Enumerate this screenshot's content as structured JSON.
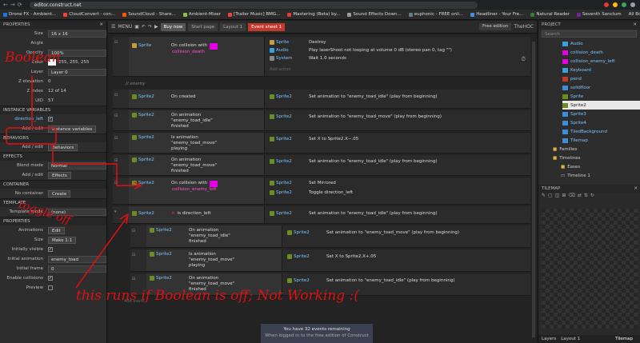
{
  "browser": {
    "url": "editor.construct.net",
    "bookmarks": [
      {
        "label": "Drone FX - Ambient...",
        "color": "#1a73e8"
      },
      {
        "label": "CloudConvert - con...",
        "color": "#f44336"
      },
      {
        "label": "SoundCloud - Share...",
        "color": "#ff5500"
      },
      {
        "label": "Ambient-Mixer",
        "color": "#8bc34a"
      },
      {
        "label": "[Trailer Music] BMG...",
        "color": "#f44336"
      },
      {
        "label": "Mastering (Beta) by...",
        "color": "#e53935"
      },
      {
        "label": "Sound Effects Down...",
        "color": "#9e9e9e"
      },
      {
        "label": "euphonic - FREE onli...",
        "color": "#607d8b"
      },
      {
        "label": "Headliner - Your Fre...",
        "color": "#4a90e2"
      },
      {
        "label": "Natural Reader",
        "color": "#2e7d32"
      },
      {
        "label": "Seventh Sanctum",
        "color": "#7b1fa2"
      }
    ],
    "all_bookmarks": "All Bookmarks"
  },
  "left_panel": {
    "title": "PROPERTIES",
    "size_label": "Size",
    "size_value": "16 x 16",
    "angle_label": "Angle",
    "opacity_label": "Opacity",
    "opacity_value": "100%",
    "color_label": "Color",
    "color_value": "255, 255, 255",
    "layer_label": "Layer",
    "layer_value": "Layer 0",
    "zelev_label": "Z elevation",
    "zelev_value": "0",
    "zindex_label": "Z index",
    "zindex_value": "12 of 14",
    "uid_label": "UID",
    "uid_value": "57",
    "instance_vars_section": "INSTANCE VARIABLES",
    "var_name": "direction_left",
    "addedit_label": "Add / edit",
    "instance_vars_button": "Instance variables",
    "behaviors_section": "BEHAVIORS",
    "behaviors_addedit": "Add / edit",
    "behaviors_button": "Behaviors",
    "effects_section": "EFFECTS",
    "blend_label": "Blend mode",
    "blend_value": "Normal",
    "effects_addedit": "Add / edit",
    "effects_button": "Effects",
    "container_section": "CONTAINER",
    "container_label": "No container",
    "create_button": "Create",
    "template_section": "TEMPLATE",
    "template_mode_label": "Template mode",
    "template_mode_value": "(none)",
    "properties_section": "PROPERTIES",
    "animations_label": "Animations",
    "edit_button": "Edit",
    "size2_label": "Size",
    "make11_button": "Make 1:1",
    "initially_visible_label": "Initially visible",
    "initial_anim_label": "Initial animation",
    "initial_anim_value": "enemy_toad",
    "initial_frame_label": "Initial frame",
    "initial_frame_value": "0",
    "enable_collisions_label": "Enable collisions",
    "preview_label": "Preview"
  },
  "toolbar": {
    "menu": "MENU",
    "tabs": [
      "Start page",
      "Layout 1",
      "Event sheet 1"
    ],
    "buy_now": "Buy now",
    "free_edition": "Free edition",
    "user": "TheHOC"
  },
  "events": {
    "comment": "// enemy",
    "e1_obj": "Sprite",
    "e1_cond": "On collision with",
    "e1_target": "collision_death",
    "e1_a1_obj": "Sprite",
    "e1_a1": "Destroy",
    "e1_a2_obj": "Audio",
    "e1_a2": "Play laserShoot not looping at volume 0 dB (stereo pan 0, tag \"\")",
    "e1_a3_obj": "System",
    "e1_a3": "Wait 1.0 seconds",
    "add_action": "Add action",
    "e2_obj": "Sprite2",
    "e2_cond": "On created",
    "e2_act": "Set animation to \"enemy_toad_idle\" (play from beginning)",
    "e3_cond": "On animation \"enemy_toad_idle\" finished",
    "e3_act": "Set animation to \"enemy_toad_move\" (play from beginning)",
    "e4_cond": "Is animation \"enemy_toad_move\" playing",
    "e4_act": "Set X to Sprite2.X−.05",
    "e5_cond": "On animation \"enemy_toad_move\" finished",
    "e5_act": "Set animation to \"enemy_toad_idle\" (play from beginning)",
    "e6_cond": "On collision with",
    "e6_target": "collision_enemy_left",
    "e6_a1": "Set Mirrored",
    "e6_a2": "Toggle direction_left",
    "e7_cond": "is direction_left",
    "e7_act": "Set animation to \"enemy_toad_idle\" (play from beginning)",
    "s1_cond": "On animation \"enemy_toad_idle\" finished",
    "s1_act": "Set animation to \"enemy_toad_move\" (play from beginning)",
    "s2_cond": "Is animation \"enemy_toad_move\" playing",
    "s2_act": "Set X to Sprite2.X+.05",
    "s3_cond": "On animation \"enemy_toad_move\" finished",
    "s3_act": "Set animation to \"enemy_toad_idle\" (play from beginning)",
    "add_event": "Add event"
  },
  "notice": {
    "title": "You have 32 events remaining",
    "body": "When logged in to the free edition of Construct"
  },
  "project": {
    "title": "PROJECT",
    "search_placeholder": "Search",
    "items": [
      "Audio",
      "collision_death",
      "collision_enemy_left",
      "Keyboard",
      "pend",
      "solidfloor",
      "Sprite",
      "Sprite2",
      "Sprite3",
      "Sprite4",
      "TiledBackground",
      "Tilemap"
    ],
    "families": "Families",
    "timelines": "Timelines",
    "eases": "Eases",
    "timeline1": "Timeline 1"
  },
  "tilemap_panel": {
    "title": "TILEMAP",
    "bottom_tabs": [
      "Layers",
      "Layout 1",
      "Tilemap"
    ]
  },
  "annotations": {
    "boolean": "Boolean",
    "toggle_off": "toggle off",
    "runs_off": "this runs if Boolean is off; Not Working :("
  },
  "colors": {
    "accent_red": "#c0392b",
    "magenta": "#e600e6",
    "annotation_red": "#e01010"
  }
}
